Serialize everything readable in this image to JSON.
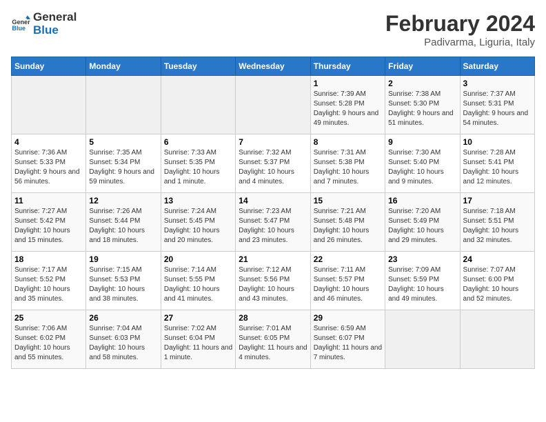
{
  "header": {
    "logo_line1": "General",
    "logo_line2": "Blue",
    "title": "February 2024",
    "subtitle": "Padivarma, Liguria, Italy"
  },
  "weekdays": [
    "Sunday",
    "Monday",
    "Tuesday",
    "Wednesday",
    "Thursday",
    "Friday",
    "Saturday"
  ],
  "weeks": [
    [
      {
        "day": "",
        "info": ""
      },
      {
        "day": "",
        "info": ""
      },
      {
        "day": "",
        "info": ""
      },
      {
        "day": "",
        "info": ""
      },
      {
        "day": "1",
        "info": "Sunrise: 7:39 AM\nSunset: 5:28 PM\nDaylight: 9 hours and 49 minutes."
      },
      {
        "day": "2",
        "info": "Sunrise: 7:38 AM\nSunset: 5:30 PM\nDaylight: 9 hours and 51 minutes."
      },
      {
        "day": "3",
        "info": "Sunrise: 7:37 AM\nSunset: 5:31 PM\nDaylight: 9 hours and 54 minutes."
      }
    ],
    [
      {
        "day": "4",
        "info": "Sunrise: 7:36 AM\nSunset: 5:33 PM\nDaylight: 9 hours and 56 minutes."
      },
      {
        "day": "5",
        "info": "Sunrise: 7:35 AM\nSunset: 5:34 PM\nDaylight: 9 hours and 59 minutes."
      },
      {
        "day": "6",
        "info": "Sunrise: 7:33 AM\nSunset: 5:35 PM\nDaylight: 10 hours and 1 minute."
      },
      {
        "day": "7",
        "info": "Sunrise: 7:32 AM\nSunset: 5:37 PM\nDaylight: 10 hours and 4 minutes."
      },
      {
        "day": "8",
        "info": "Sunrise: 7:31 AM\nSunset: 5:38 PM\nDaylight: 10 hours and 7 minutes."
      },
      {
        "day": "9",
        "info": "Sunrise: 7:30 AM\nSunset: 5:40 PM\nDaylight: 10 hours and 9 minutes."
      },
      {
        "day": "10",
        "info": "Sunrise: 7:28 AM\nSunset: 5:41 PM\nDaylight: 10 hours and 12 minutes."
      }
    ],
    [
      {
        "day": "11",
        "info": "Sunrise: 7:27 AM\nSunset: 5:42 PM\nDaylight: 10 hours and 15 minutes."
      },
      {
        "day": "12",
        "info": "Sunrise: 7:26 AM\nSunset: 5:44 PM\nDaylight: 10 hours and 18 minutes."
      },
      {
        "day": "13",
        "info": "Sunrise: 7:24 AM\nSunset: 5:45 PM\nDaylight: 10 hours and 20 minutes."
      },
      {
        "day": "14",
        "info": "Sunrise: 7:23 AM\nSunset: 5:47 PM\nDaylight: 10 hours and 23 minutes."
      },
      {
        "day": "15",
        "info": "Sunrise: 7:21 AM\nSunset: 5:48 PM\nDaylight: 10 hours and 26 minutes."
      },
      {
        "day": "16",
        "info": "Sunrise: 7:20 AM\nSunset: 5:49 PM\nDaylight: 10 hours and 29 minutes."
      },
      {
        "day": "17",
        "info": "Sunrise: 7:18 AM\nSunset: 5:51 PM\nDaylight: 10 hours and 32 minutes."
      }
    ],
    [
      {
        "day": "18",
        "info": "Sunrise: 7:17 AM\nSunset: 5:52 PM\nDaylight: 10 hours and 35 minutes."
      },
      {
        "day": "19",
        "info": "Sunrise: 7:15 AM\nSunset: 5:53 PM\nDaylight: 10 hours and 38 minutes."
      },
      {
        "day": "20",
        "info": "Sunrise: 7:14 AM\nSunset: 5:55 PM\nDaylight: 10 hours and 41 minutes."
      },
      {
        "day": "21",
        "info": "Sunrise: 7:12 AM\nSunset: 5:56 PM\nDaylight: 10 hours and 43 minutes."
      },
      {
        "day": "22",
        "info": "Sunrise: 7:11 AM\nSunset: 5:57 PM\nDaylight: 10 hours and 46 minutes."
      },
      {
        "day": "23",
        "info": "Sunrise: 7:09 AM\nSunset: 5:59 PM\nDaylight: 10 hours and 49 minutes."
      },
      {
        "day": "24",
        "info": "Sunrise: 7:07 AM\nSunset: 6:00 PM\nDaylight: 10 hours and 52 minutes."
      }
    ],
    [
      {
        "day": "25",
        "info": "Sunrise: 7:06 AM\nSunset: 6:02 PM\nDaylight: 10 hours and 55 minutes."
      },
      {
        "day": "26",
        "info": "Sunrise: 7:04 AM\nSunset: 6:03 PM\nDaylight: 10 hours and 58 minutes."
      },
      {
        "day": "27",
        "info": "Sunrise: 7:02 AM\nSunset: 6:04 PM\nDaylight: 11 hours and 1 minute."
      },
      {
        "day": "28",
        "info": "Sunrise: 7:01 AM\nSunset: 6:05 PM\nDaylight: 11 hours and 4 minutes."
      },
      {
        "day": "29",
        "info": "Sunrise: 6:59 AM\nSunset: 6:07 PM\nDaylight: 11 hours and 7 minutes."
      },
      {
        "day": "",
        "info": ""
      },
      {
        "day": "",
        "info": ""
      }
    ]
  ]
}
